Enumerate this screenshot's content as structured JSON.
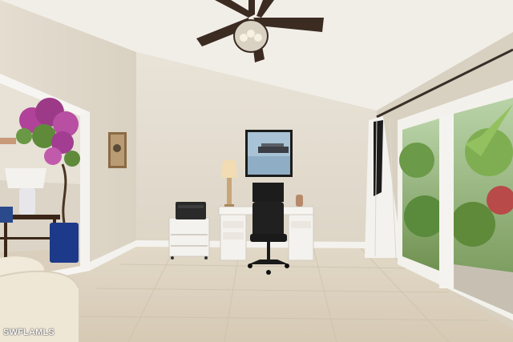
{
  "watermark": {
    "text": "SWFLAMLS"
  },
  "colors": {
    "wall": "#e6dfd3",
    "ceiling": "#f2efe9",
    "floor": "#ddd3c1",
    "trim": "#f5f3ef",
    "foliage": "#5f8a3a",
    "pot": "#1d3a8a",
    "blossom": "#b0429a"
  },
  "icons": [
    "ceiling-fan-icon",
    "printer-icon",
    "monitor-icon",
    "office-chair-icon",
    "table-lamp-icon"
  ]
}
